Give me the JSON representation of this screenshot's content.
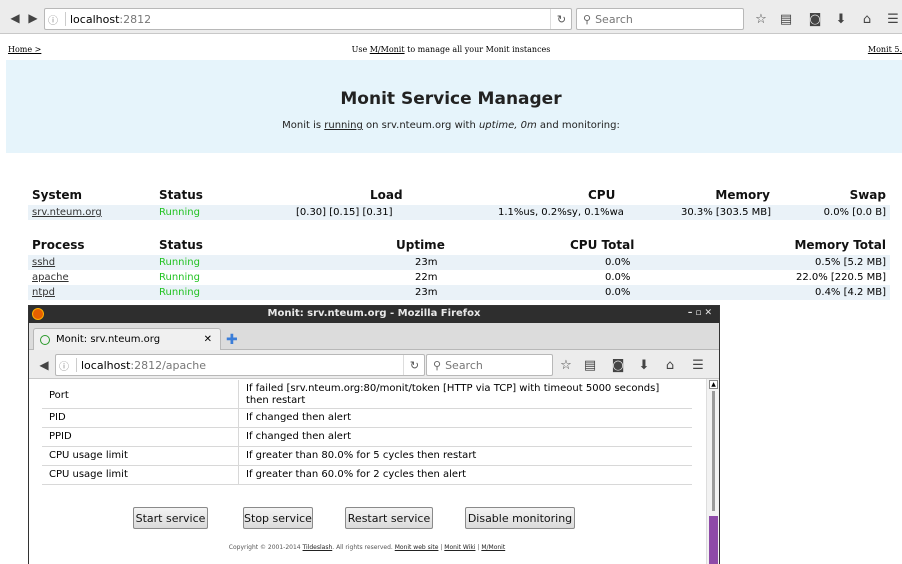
{
  "browser": {
    "url_host": "localhost",
    "url_rest": ":2812",
    "search_placeholder": "Search"
  },
  "monit_nav": {
    "home": "Home >",
    "center_pre": "Use ",
    "center_link": "M/Monit",
    "center_post": " to manage all your Monit instances",
    "right": "Monit 5."
  },
  "hero": {
    "title": "Monit Service Manager",
    "line_pre": "Monit is ",
    "line_running": "running",
    "line_mid": " on srv.nteum.org with ",
    "line_uptime": "uptime, 0m",
    "line_post": "  and monitoring:"
  },
  "system_table": {
    "headers": [
      "System",
      "Status",
      "Load",
      "CPU",
      "Memory",
      "Swap"
    ],
    "rows": [
      {
        "name": "srv.nteum.org",
        "status": "Running",
        "load": "[0.30] [0.15] [0.31]",
        "cpu": "1.1%us, 0.2%sy, 0.1%wa",
        "memory": "30.3% [303.5 MB]",
        "swap": "0.0% [0.0 B]"
      }
    ]
  },
  "process_table": {
    "headers": [
      "Process",
      "Status",
      "Uptime",
      "CPU Total",
      "Memory Total"
    ],
    "rows": [
      {
        "name": "sshd",
        "status": "Running",
        "uptime": "23m",
        "cpu": "0.0%",
        "memory": "0.5% [5.2 MB]"
      },
      {
        "name": "apache",
        "status": "Running",
        "uptime": "22m",
        "cpu": "0.0%",
        "memory": "22.0% [220.5 MB]"
      },
      {
        "name": "ntpd",
        "status": "Running",
        "uptime": "23m",
        "cpu": "0.0%",
        "memory": "0.4% [4.2 MB]"
      }
    ]
  },
  "fx_window": {
    "title": "Monit: srv.nteum.org - Mozilla Firefox",
    "tab_label": "Monit: srv.nteum.org",
    "url_host": "localhost",
    "url_rest": ":2812/apache",
    "search_placeholder": "Search"
  },
  "rules": [
    {
      "key": "Port",
      "value": "If failed [srv.nteum.org:80/monit/token [HTTP via TCP] with timeout 5000 seconds] then restart"
    },
    {
      "key": "PID",
      "value": "If changed then alert"
    },
    {
      "key": "PPID",
      "value": "If changed then alert"
    },
    {
      "key": "CPU usage limit",
      "value": "If greater than 80.0% for 5 cycles then restart"
    },
    {
      "key": "CPU usage limit",
      "value": "If greater than 60.0% for 2 cycles then alert"
    }
  ],
  "buttons": {
    "start": "Start service",
    "stop": "Stop service",
    "restart": "Restart service",
    "disable": "Disable monitoring"
  },
  "footer": {
    "pre": "Copyright © 2001-2014 ",
    "tildeslash": "Tildeslash",
    "mid": ". All rights reserved.  ",
    "web": "Monit web site",
    "wiki": "Monit Wiki",
    "mmonit": "M/Monit"
  }
}
